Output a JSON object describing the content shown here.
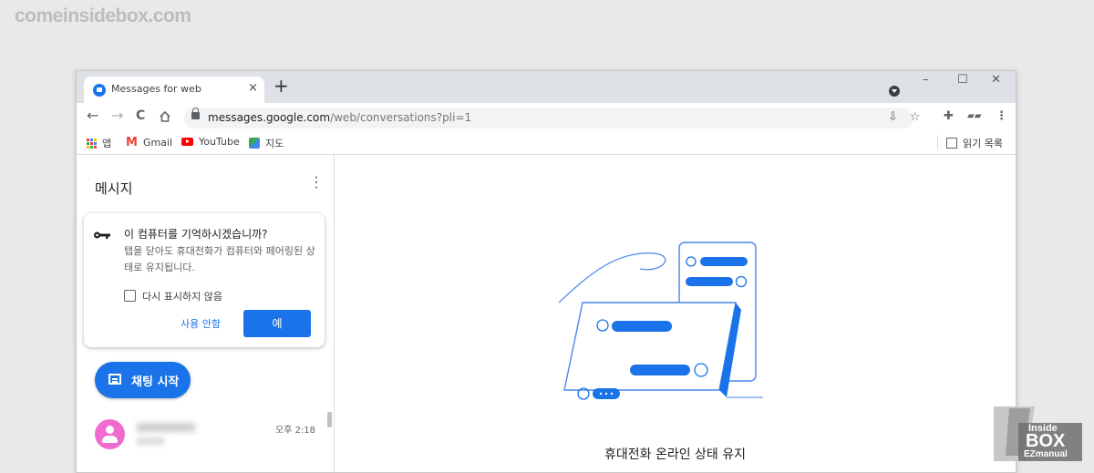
{
  "watermark": {
    "site": "comeinsidebox.com",
    "logo_line1": "Inside",
    "logo_line2": "BOX",
    "logo_line3": "EZmanual"
  },
  "browser": {
    "tab_title": "Messages for web",
    "tab_close": "×",
    "new_tab": "+",
    "controls": {
      "minimize": "–",
      "maximize": "☐",
      "close": "✕"
    },
    "nav": {
      "back": "←",
      "forward": "→",
      "reload": "C"
    },
    "url_host": "messages.google.com",
    "url_path": "/web/conversations?pli=1",
    "bookmarks": [
      {
        "label": "앱",
        "icon": "apps-grid-icon"
      },
      {
        "label": "Gmail",
        "icon": "gmail-icon"
      },
      {
        "label": "YouTube",
        "icon": "youtube-icon"
      },
      {
        "label": "지도",
        "icon": "maps-icon"
      }
    ],
    "reading_list": "읽기 목록"
  },
  "sidebar": {
    "title": "메시지",
    "menu": "⋮",
    "remember_card": {
      "title": "이 컴퓨터를 기억하시겠습니까?",
      "body": "탭을 닫아도 휴대전화가 컴퓨터와 페어링된 상태로 유지됩니다.",
      "checkbox_label": "다시 표시하지 않음",
      "decline": "사용 안함",
      "accept": "예"
    },
    "start_chat": "채팅 시작",
    "conversations": [
      {
        "time": "오후 2:18"
      }
    ]
  },
  "main": {
    "caption": "휴대전화 온라인 상태 유지"
  },
  "colors": {
    "accent": "#1a73e8",
    "avatar": "#f06bd0"
  }
}
